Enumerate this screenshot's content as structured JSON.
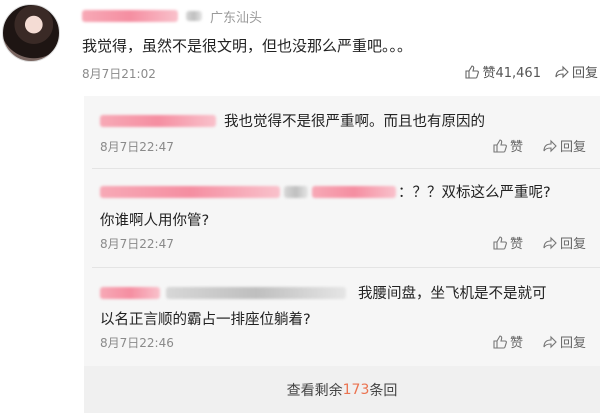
{
  "comment": {
    "location": "广东汕头",
    "text": "我觉得，虽然不是很文明，但也没那么严重吧。。。",
    "time": "8月7日21:02",
    "like_label": "赞41,461",
    "reply_label": "回复"
  },
  "replies": [
    {
      "text": "我也觉得不是很严重啊。而且也有原因的",
      "time": "8月7日22:47",
      "like_label": "赞",
      "reply_label": "回复"
    },
    {
      "text_1": "：？？双标这么严重呢?",
      "text_2": "你谁啊人用你管?",
      "time": "8月7日22:47",
      "like_label": "赞",
      "reply_label": "回复"
    },
    {
      "text_1": "我腰间盘，坐飞机是不是就可",
      "text_2": "以名正言顺的霸占一排座位躺着?",
      "time": "8月7日22:46",
      "like_label": "赞",
      "reply_label": "回复"
    }
  ],
  "more_replies": {
    "prefix": "查看剩余",
    "count": "173",
    "suffix": "条回"
  },
  "colors": {
    "accent": "#eb7350",
    "reply_bg": "#f6f6f6"
  },
  "icons": [
    "thumb-up-icon",
    "share-arrow-icon"
  ]
}
